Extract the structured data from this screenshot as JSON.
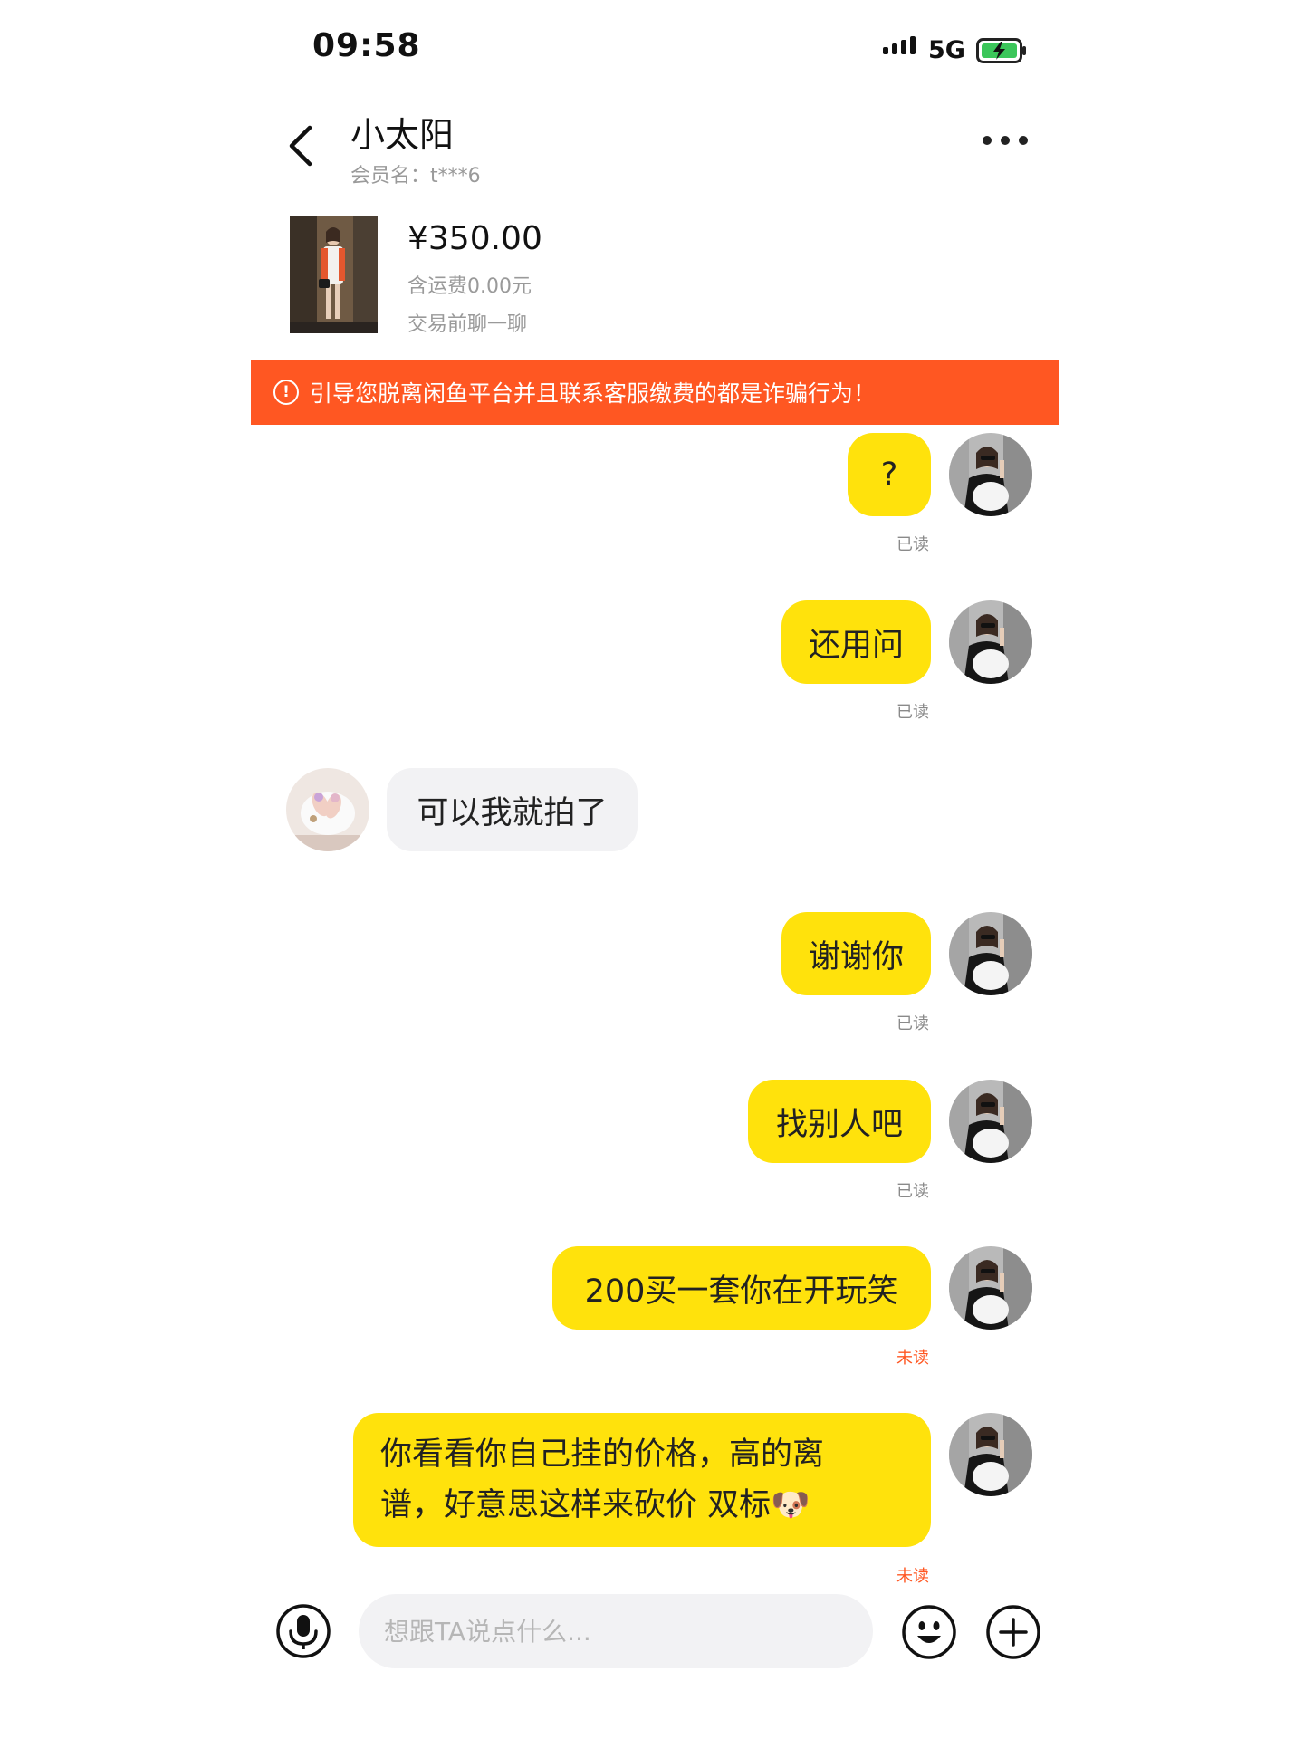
{
  "status_bar": {
    "time": "09:58",
    "network": "5G",
    "battery_icon": "battery-charging-icon"
  },
  "header": {
    "contact_name": "小太阳",
    "member_name": "会员名：t***6"
  },
  "product": {
    "price": "¥350.00",
    "shipping": "含运费0.00元",
    "note": "交易前聊一聊"
  },
  "warning": {
    "text": "引导您脱离闲鱼平台并且联系客服缴费的都是诈骗行为！"
  },
  "messages": [
    {
      "from": "me",
      "text": "?",
      "status": "已读"
    },
    {
      "from": "me",
      "text": "还用问",
      "status": "已读"
    },
    {
      "from": "other",
      "text": "可以我就拍了"
    },
    {
      "from": "me",
      "text": "谢谢你",
      "status": "已读"
    },
    {
      "from": "me",
      "text": "找别人吧",
      "status": "已读"
    },
    {
      "from": "me",
      "text": "200买一套你在开玩笑",
      "status": "未读"
    },
    {
      "from": "me",
      "line1": "你看看你自己挂的价格，高的离",
      "line2": "谱，好意思这样来砍价 双标",
      "emoji": "🐶",
      "status": "未读"
    }
  ],
  "input_bar": {
    "placeholder": "想跟TA说点什么...",
    "icons": [
      "microphone-icon",
      "emoji-icon",
      "plus-icon"
    ]
  },
  "colors": {
    "accent": "#ffe20c",
    "warning": "#ff5722",
    "unread": "#ff5722"
  }
}
